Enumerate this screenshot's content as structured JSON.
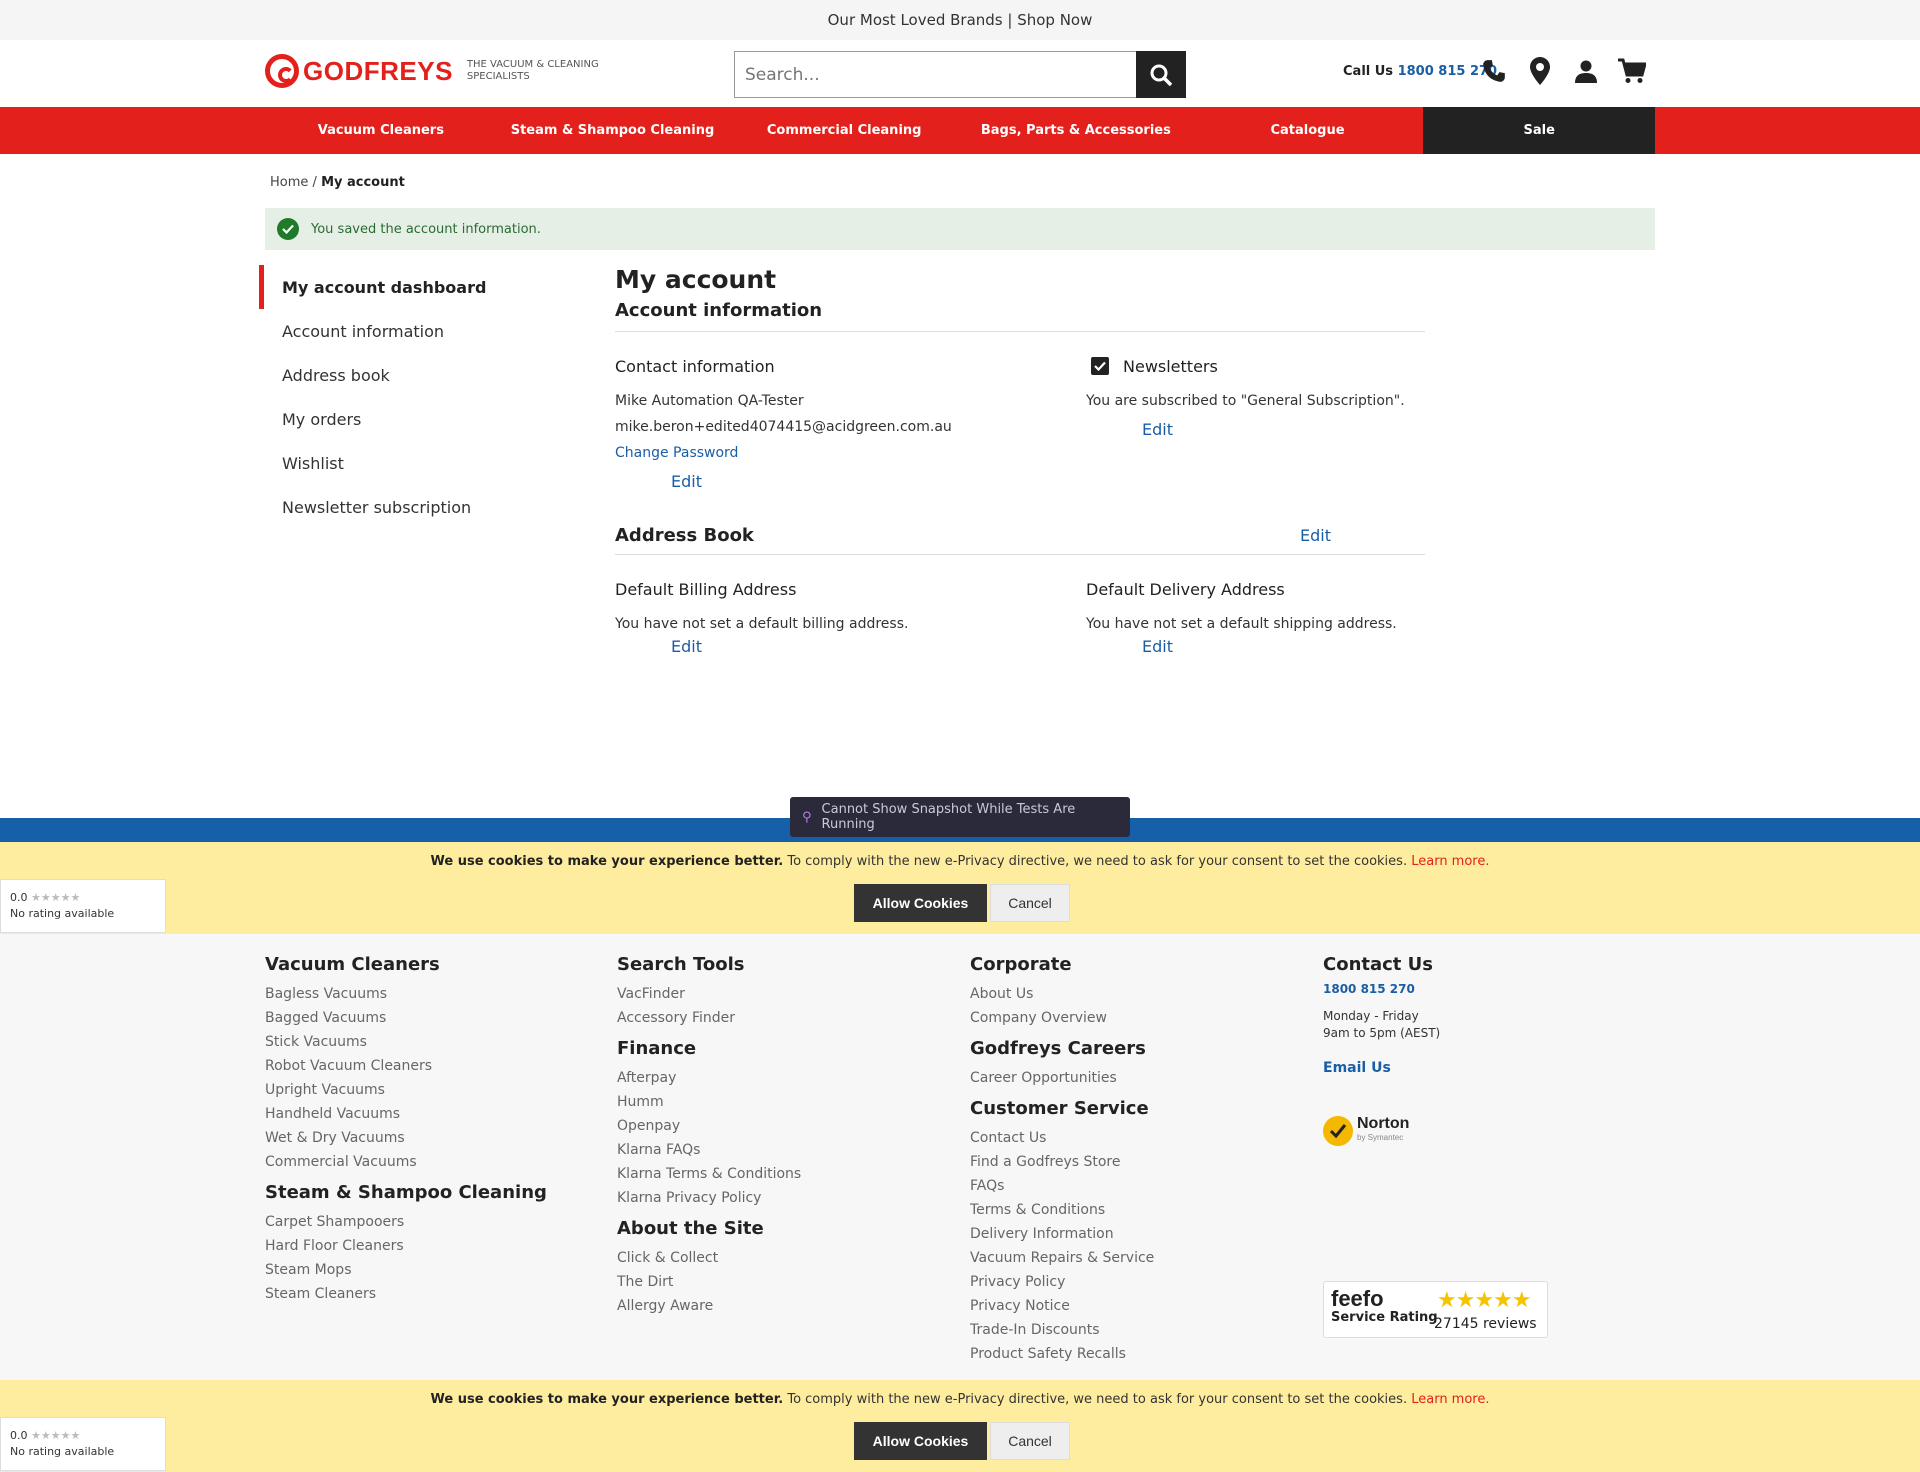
{
  "promo": {
    "text": "Our Most Loved Brands | Shop Now"
  },
  "header": {
    "brand": "GODFREYS",
    "tagline": "THE VACUUM & CLEANING SPECIALISTS",
    "search_placeholder": "Search...",
    "call_label": "Call Us",
    "phone": "1800 815 270",
    "icons": [
      "phone-icon",
      "location-pin-icon",
      "account-icon",
      "cart-icon"
    ]
  },
  "nav": {
    "items": [
      "Vacuum Cleaners",
      "Steam & Shampoo Cleaning",
      "Commercial Cleaning",
      "Bags, Parts & Accessories",
      "Catalogue",
      "Sale"
    ]
  },
  "breadcrumb": {
    "home": "Home",
    "separator": "/",
    "current": "My account"
  },
  "alert": {
    "message": "You saved the account information."
  },
  "sidebar": {
    "items": [
      {
        "label": "My account dashboard",
        "active": true
      },
      {
        "label": "Account information"
      },
      {
        "label": "Address book"
      },
      {
        "label": "My orders"
      },
      {
        "label": "Wishlist"
      },
      {
        "label": "Newsletter subscription"
      }
    ]
  },
  "main": {
    "title": "My account",
    "account_info": {
      "heading": "Account information",
      "contact": {
        "title": "Contact information",
        "name": "Mike Automation QA-Tester",
        "email": "mike.beron+edited4074415@acidgreen.com.au",
        "change_password": "Change Password",
        "edit": "Edit"
      },
      "newsletters": {
        "title": "Newsletters",
        "text": "You are subscribed to \"General Subscription\".",
        "edit": "Edit",
        "checked": true
      }
    },
    "address_book": {
      "heading": "Address Book",
      "edit": "Edit",
      "billing": {
        "title": "Default Billing Address",
        "text": "You have not set a default billing address.",
        "edit": "Edit"
      },
      "delivery": {
        "title": "Default Delivery Address",
        "text": "You have not set a default shipping address.",
        "edit": "Edit"
      }
    }
  },
  "snapshot": {
    "text": "Cannot Show Snapshot While Tests Are Running"
  },
  "cookie": {
    "bold": "We use cookies to make your experience better.",
    "text": " To comply with the new e-Privacy directive, we need to ask for your consent to set the cookies. ",
    "learn": "Learn more.",
    "allow": "Allow Cookies",
    "cancel": "Cancel"
  },
  "rating_widget": {
    "score": "0.0",
    "stars": "★★★★★",
    "text": "No rating available"
  },
  "footer": {
    "col1": [
      {
        "heading": "Vacuum Cleaners",
        "links": [
          "Bagless Vacuums",
          "Bagged Vacuums",
          "Stick Vacuums",
          "Robot Vacuum Cleaners",
          "Upright Vacuums",
          "Handheld Vacuums",
          "Wet & Dry Vacuums",
          "Commercial Vacuums"
        ]
      },
      {
        "heading": "Steam & Shampoo Cleaning",
        "links": [
          "Carpet Shampooers",
          "Hard Floor Cleaners",
          "Steam Mops",
          "Steam Cleaners"
        ]
      }
    ],
    "col2": [
      {
        "heading": "Search Tools",
        "links": [
          "VacFinder",
          "Accessory Finder"
        ]
      },
      {
        "heading": "Finance",
        "links": [
          "Afterpay",
          "Humm",
          "Openpay",
          "Klarna FAQs",
          "Klarna Terms & Conditions",
          "Klarna Privacy Policy"
        ]
      },
      {
        "heading": "About the Site",
        "links": [
          "Click & Collect",
          "The Dirt",
          "Allergy Aware"
        ]
      }
    ],
    "col3": [
      {
        "heading": "Corporate",
        "links": [
          "About Us",
          "Company Overview"
        ]
      },
      {
        "heading": "Godfreys Careers",
        "links": [
          "Career Opportunities"
        ]
      },
      {
        "heading": "Customer Service",
        "links": [
          "Contact Us",
          "Find a Godfreys Store",
          "FAQs",
          "Terms & Conditions",
          "Delivery Information",
          "Vacuum Repairs & Service",
          "Privacy Policy",
          "Privacy Notice",
          "Trade-In Discounts",
          "Product Safety Recalls"
        ]
      }
    ],
    "contact": {
      "heading": "Contact Us",
      "phone": "1800 815 270",
      "days": "Monday - Friday",
      "hours": "9am to 5pm (AEST)",
      "email": "Email Us"
    },
    "norton": {
      "name": "Norton",
      "sub": "by Symantec"
    },
    "feefo": {
      "brand": "feefo",
      "label": "Service Rating",
      "stars": "★★★★★",
      "reviews": "27145 reviews"
    }
  }
}
